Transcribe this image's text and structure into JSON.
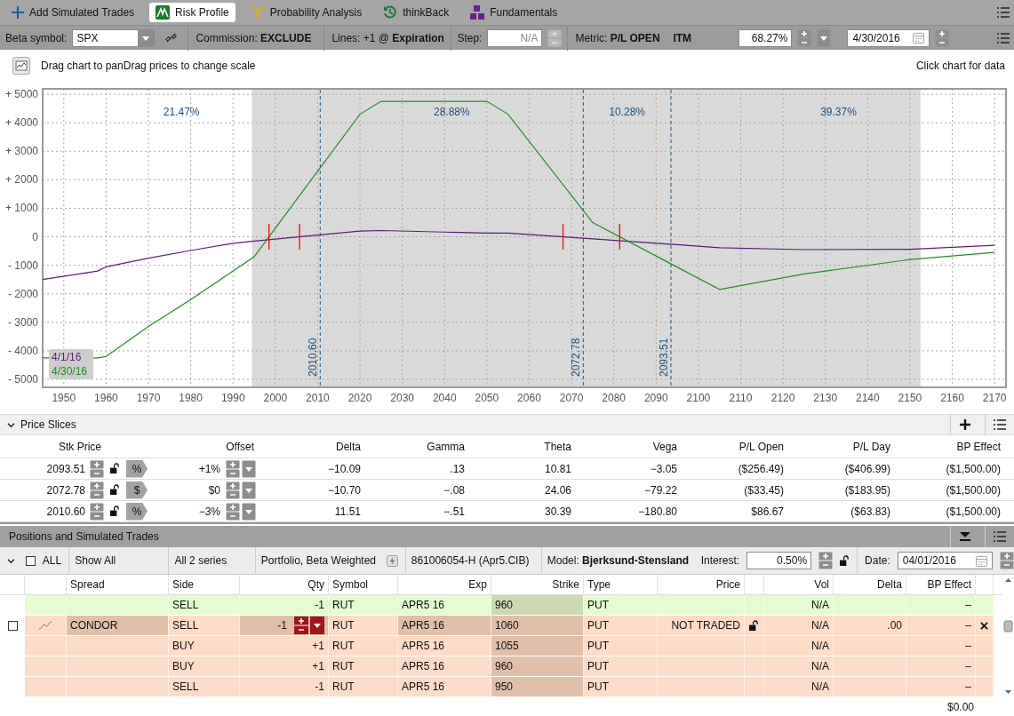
{
  "tabs": [
    {
      "label": "Add Simulated Trades",
      "selected": false
    },
    {
      "label": "Risk Profile",
      "selected": true
    },
    {
      "label": "Probability Analysis",
      "selected": false
    },
    {
      "label": "thinkBack",
      "selected": false
    },
    {
      "label": "Fundamentals",
      "selected": false
    }
  ],
  "toolbar": {
    "beta_label": "Beta symbol:",
    "beta_symbol": "SPX",
    "commission": "Commission: **EXCLUDE**",
    "lines": "Lines: +1 @ **Expiration**",
    "step": {
      "label": "Step:",
      "value": "N/A",
      "disabled": true
    },
    "metric": "Metric: **P/L OPEN**",
    "itm": "ITM",
    "probability": "68.27%",
    "date": "4/30/2016"
  },
  "chart": {
    "hint": "Drag chart to panDrag prices to change scale",
    "click_hint": "Click chart for data",
    "chart_data": {
      "type": "line",
      "x": [
        1945,
        1958,
        1960,
        1970,
        1980,
        1990,
        1995,
        2020,
        2025,
        2050,
        2055,
        2075,
        2105,
        2125,
        2150,
        2170
      ],
      "series": [
        {
          "name": "4/1/16",
          "color": "#5c1c7c",
          "values": [
            -1500,
            -1200,
            -1050,
            -750,
            -480,
            -230,
            -150,
            200,
            220,
            130,
            130,
            -70,
            -380,
            -450,
            -440,
            -300
          ]
        },
        {
          "name": "4/30/16",
          "color": "#1f8c1f",
          "values": [
            -4250,
            -4250,
            -4200,
            -3150,
            -2200,
            -1200,
            -700,
            4300,
            4750,
            4750,
            4300,
            500,
            -1850,
            -1300,
            -800,
            -550
          ]
        }
      ],
      "xlim": [
        1945,
        2172.7
      ],
      "ylim": [
        -5280,
        5190
      ],
      "xticks": [
        1950,
        1960,
        1970,
        1980,
        1990,
        2000,
        2010,
        2020,
        2030,
        2040,
        2050,
        2060,
        2070,
        2080,
        2090,
        2100,
        2110,
        2120,
        2130,
        2140,
        2150,
        2160,
        2170
      ],
      "yticks": [
        {
          "value": 5000,
          "label": "+ 5000"
        },
        {
          "value": 4000,
          "label": "+ 4000"
        },
        {
          "value": 3000,
          "label": "+ 3000"
        },
        {
          "value": 2000,
          "label": "+ 2000"
        },
        {
          "value": 1000,
          "label": "+ 1000"
        },
        {
          "value": 0,
          "label": "0"
        },
        {
          "value": -1000,
          "label": "- 1000"
        },
        {
          "value": -2000,
          "label": "- 2000"
        },
        {
          "value": -3000,
          "label": "- 3000"
        },
        {
          "value": -4000,
          "label": "- 4000"
        },
        {
          "value": -5000,
          "label": "- 5000"
        }
      ],
      "grid": true,
      "bands": [
        {
          "axis": "x",
          "from": 1994.5,
          "to": 2152.5
        }
      ],
      "ref_lines": [
        {
          "axis": "x",
          "value": 2010.6,
          "label": "2010.60"
        },
        {
          "axis": "x",
          "value": 2072.78,
          "label": "2072.78"
        },
        {
          "axis": "x",
          "value": 2093.51,
          "label": "2093.51"
        }
      ]
    },
    "probabilities": [
      "21.47%",
      "28.88%",
      "10.28%",
      "39.37%"
    ]
  },
  "price_slices": {
    "title": "Price Slices",
    "expanded": true,
    "columns": [
      "Stk Price",
      "Offset",
      "Delta",
      "Gamma",
      "Theta",
      "Vega",
      "P/L Open",
      "P/L Day",
      "BP Effect"
    ],
    "rows": [
      {
        "stk_price": "2093.51",
        "unit": "%",
        "offset": "+1%",
        "delta": "−10.09",
        "gamma": ".13",
        "theta": "10.81",
        "vega": "−3.05",
        "pl_open": "($256.49)",
        "pl_day": "($406.99)",
        "bp_effect": "($1,500.00)"
      },
      {
        "stk_price": "2072.78",
        "unit": "$",
        "offset": "$0",
        "delta": "−10.70",
        "gamma": "−.08",
        "theta": "24.06",
        "vega": "−79.22",
        "pl_open": "($33.45)",
        "pl_day": "($183.95)",
        "bp_effect": "($1,500.00)"
      },
      {
        "stk_price": "2010.60",
        "unit": "%",
        "offset": "−3%",
        "delta": "11.51",
        "gamma": "−.51",
        "theta": "30.39",
        "vega": "−180.80",
        "pl_open": "$86.67",
        "pl_day": "($63.83)",
        "bp_effect": "($1,500.00)"
      }
    ]
  },
  "positions": {
    "title": "Positions and Simulated Trades",
    "filter": {
      "all_label": "ALL",
      "all_checked": false,
      "show": "Show All",
      "series": "All 2 series",
      "portfolio": "Portfolio, Beta Weighted",
      "account": "861006054-H (Apr5.CIB)",
      "model": "Model: **Bjerksund-Stensland**",
      "interest_label": "Interest:",
      "interest": "0.50%",
      "date_label": "Date:",
      "date": "04/01/2016"
    },
    "columns": [
      "Spread",
      "Side",
      "Qty",
      "Symbol",
      "Exp",
      "Strike",
      "Type",
      "Price",
      "Vol",
      "Delta",
      "BP Effect"
    ],
    "groups": [
      {
        "color": "#e4fcd0",
        "legs": [
          {
            "side": "SELL",
            "qty": "-1",
            "symbol": "RUT",
            "exp": "APR5 16",
            "strike": "960",
            "type": "PUT",
            "vol": "N/A",
            "bp_effect": "–"
          }
        ]
      },
      {
        "color": "#fddcc8",
        "checked": false,
        "spread": "CONDOR",
        "price": "NOT TRADED",
        "delta": ".00",
        "legs": [
          {
            "side": "SELL",
            "qty": "-1",
            "symbol": "RUT",
            "exp": "APR5 16",
            "strike": "1060",
            "type": "PUT",
            "vol": "N/A",
            "bp_effect": "–"
          },
          {
            "side": "BUY",
            "qty": "+1",
            "symbol": "RUT",
            "exp": "APR5 16",
            "strike": "1055",
            "type": "PUT",
            "vol": "N/A",
            "bp_effect": "–"
          },
          {
            "side": "BUY",
            "qty": "+1",
            "symbol": "RUT",
            "exp": "APR5 16",
            "strike": "960",
            "type": "PUT",
            "vol": "N/A",
            "bp_effect": "–"
          },
          {
            "side": "SELL",
            "qty": "-1",
            "symbol": "RUT",
            "exp": "APR5 16",
            "strike": "950",
            "type": "PUT",
            "vol": "N/A",
            "bp_effect": "–"
          }
        ]
      }
    ],
    "total_bp_effect": "$0.00"
  }
}
